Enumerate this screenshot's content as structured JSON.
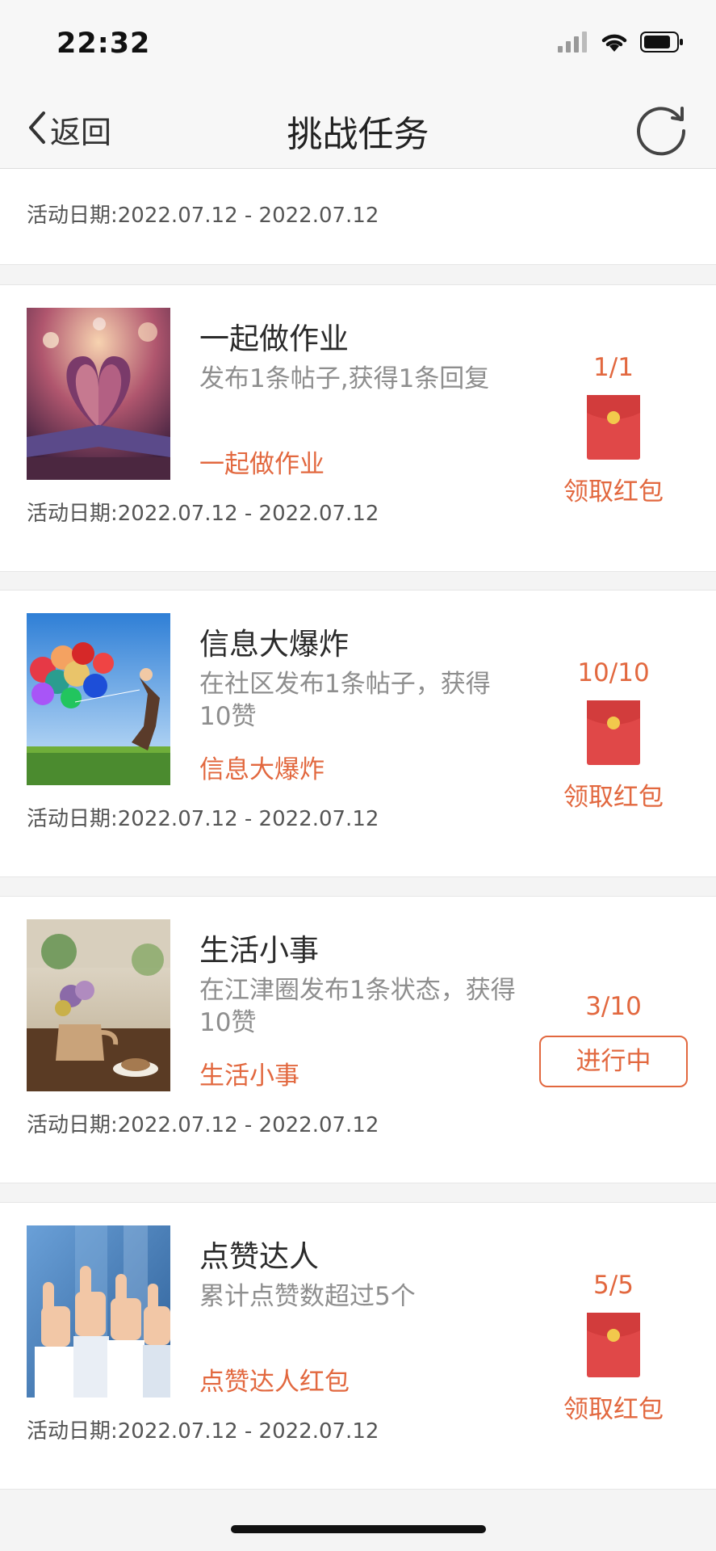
{
  "status_bar": {
    "time": "22:32"
  },
  "nav": {
    "back_label": "返回",
    "title": "挑战任务"
  },
  "top_partial_card": {
    "date_label": "活动日期:",
    "date_range": "2022.07.12 - 2022.07.12"
  },
  "tasks": [
    {
      "title": "一起做作业",
      "description": "发布1条帖子,获得1条回复",
      "tag": "一起做作业",
      "date_label": "活动日期:",
      "date_range": "2022.07.12 - 2022.07.12",
      "progress": "1/1",
      "action": "领取红包",
      "action_type": "envelope",
      "image": "heart-book-photo"
    },
    {
      "title": "信息大爆炸",
      "description": "在社区发布1条帖子，获得10赞",
      "tag": "信息大爆炸",
      "date_label": "活动日期:",
      "date_range": "2022.07.12 - 2022.07.12",
      "progress": "10/10",
      "action": "领取红包",
      "action_type": "envelope",
      "image": "balloons-photo"
    },
    {
      "title": "生活小事",
      "description": "在江津圈发布1条状态，获得10赞",
      "tag": "生活小事",
      "date_label": "活动日期:",
      "date_range": "2022.07.12 - 2022.07.12",
      "progress": "3/10",
      "action": "进行中",
      "action_type": "button",
      "image": "teapot-table-photo"
    },
    {
      "title": "点赞达人",
      "description": "累计点赞数超过5个",
      "tag": "点赞达人红包",
      "date_label": "活动日期:",
      "date_range": "2022.07.12 - 2022.07.12",
      "progress": "5/5",
      "action": "领取红包",
      "action_type": "envelope",
      "image": "thumbs-up-photo"
    }
  ],
  "colors": {
    "accent": "#e2683f",
    "envelope": "#e04848",
    "envelope_seal": "#f2c94c",
    "background": "#f4f4f4"
  }
}
